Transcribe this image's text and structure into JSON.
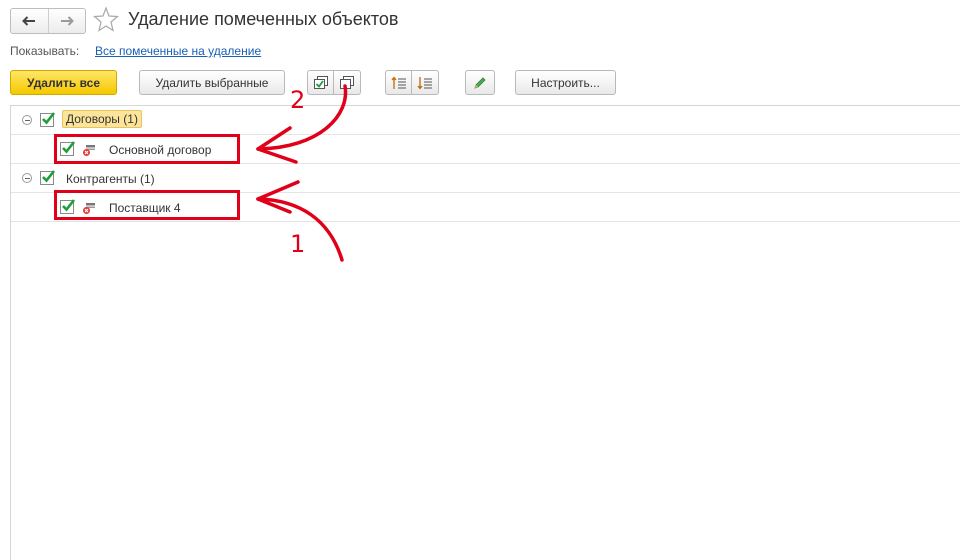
{
  "header": {
    "title": "Удаление помеченных объектов",
    "nav_back_icon": "arrow-left-icon",
    "nav_forward_icon": "arrow-right-icon",
    "favorite_icon": "star-icon"
  },
  "filter": {
    "label": "Показывать:",
    "value": "Все помеченные на удаление"
  },
  "toolbar": {
    "delete_all": "Удалить все",
    "delete_selected": "Удалить выбранные",
    "configure": "Настроить...",
    "icons": [
      "check-all-icon",
      "uncheck-all-icon",
      "expand-all-icon",
      "collapse-all-icon",
      "edit-icon"
    ]
  },
  "tree": {
    "groups": [
      {
        "label": "Договоры (1)",
        "checked": true,
        "items": [
          {
            "label": "Основной договор",
            "checked": true
          }
        ]
      },
      {
        "label": "Контрагенты (1)",
        "checked": true,
        "items": [
          {
            "label": "Поставщик 4",
            "checked": true
          }
        ]
      }
    ]
  },
  "annotations": {
    "first": "1",
    "second": "2",
    "color": "#e0001a"
  },
  "colors": {
    "primary_button": "#f5c800",
    "link": "#1a5fb4",
    "checkmark": "#1e9e3a"
  }
}
